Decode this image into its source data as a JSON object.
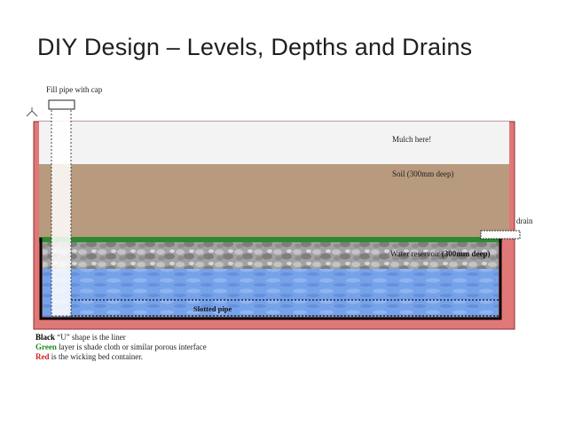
{
  "title": "DIY Design – Levels, Depths and Drains",
  "labels": {
    "fill_pipe": "Fill pipe with cap",
    "mulch": "Mulch here!",
    "soil": "Soil (300mm deep)",
    "drain": "drain",
    "reservoir_prefix": "Water reservoir ",
    "reservoir_bold": "(300mm deep)",
    "slotted_pipe": "Slotted pipe"
  },
  "legend": [
    {
      "key": "Black",
      "text": " “U” shape is the liner",
      "color": "#000000"
    },
    {
      "key": "Green",
      "text": " layer is shade cloth or similar porous interface",
      "color": "#1e8a1e"
    },
    {
      "key": "Red",
      "text": " is the wicking bed container.",
      "color": "#d42020"
    }
  ],
  "colors": {
    "container": "#e07878",
    "mulch": "#f3f3f3",
    "soil": "#b89a7e",
    "cloth": "#2f8a2f",
    "gravel": "#9c9c9c",
    "water": "#6f9ce6",
    "liner": "#000000"
  }
}
